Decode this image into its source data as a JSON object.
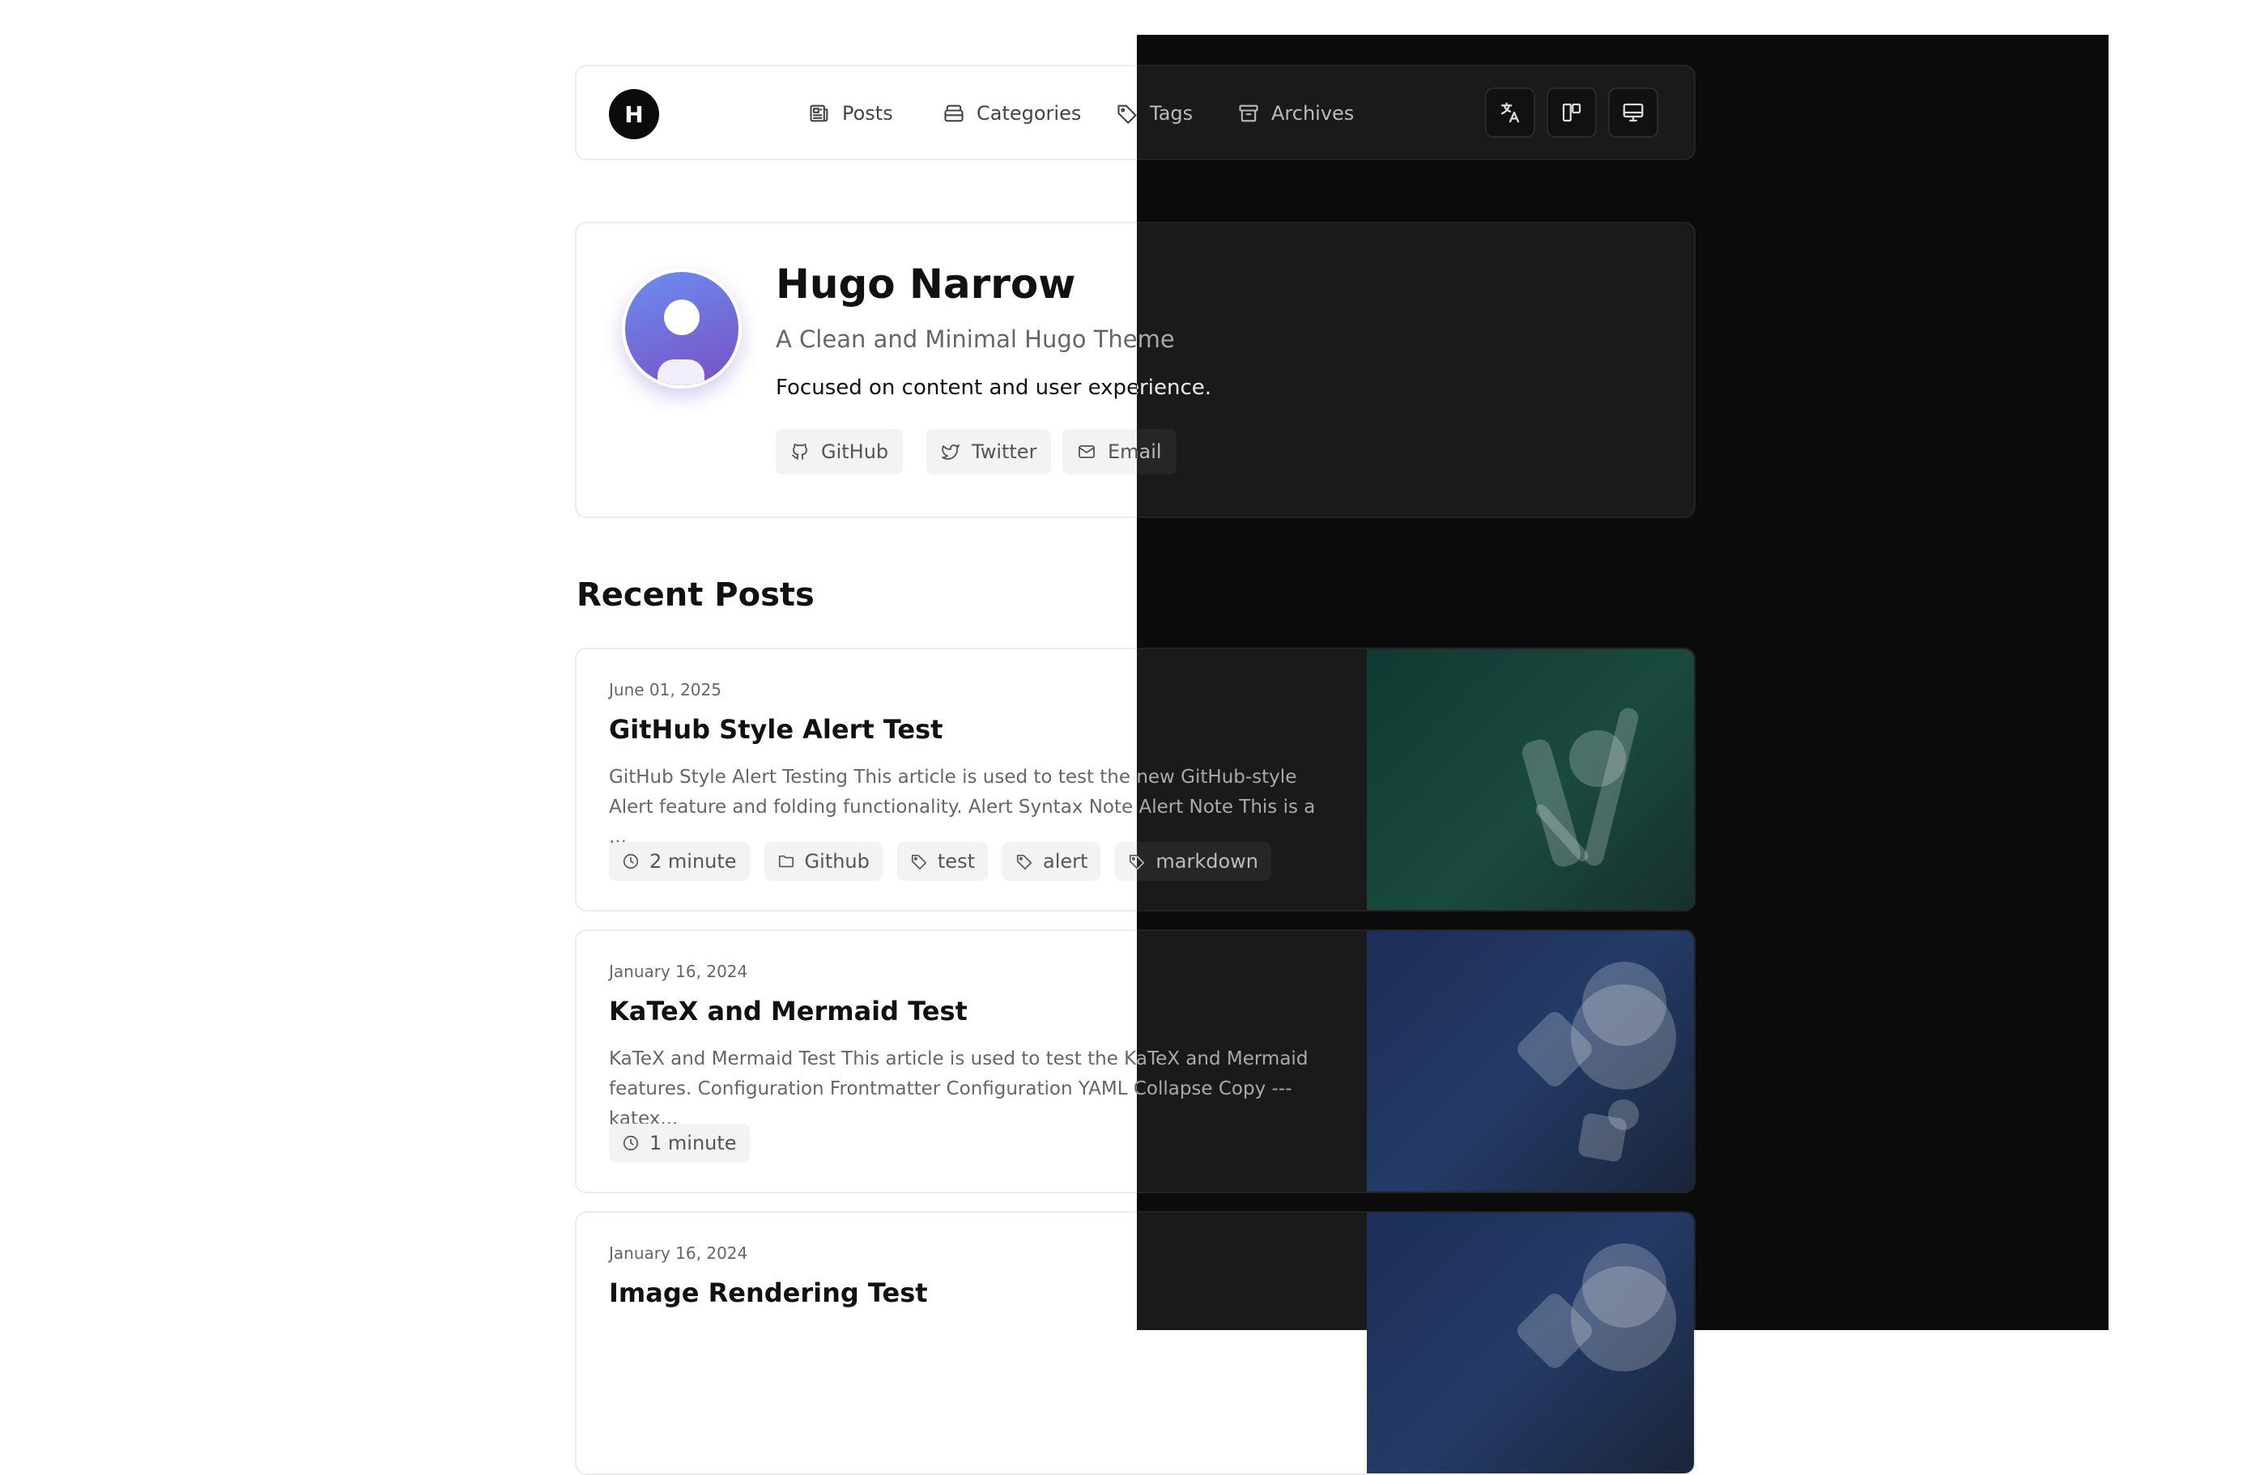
{
  "site": {
    "logo_letter": "H"
  },
  "nav": {
    "items": [
      {
        "label": "Posts",
        "icon": "newspaper-icon"
      },
      {
        "label": "Categories",
        "icon": "folder-icon"
      },
      {
        "label": "Tags",
        "icon": "tag-icon"
      },
      {
        "label": "Archives",
        "icon": "archive-icon"
      }
    ],
    "actions": [
      {
        "icon": "language-icon"
      },
      {
        "icon": "layout-icon"
      },
      {
        "icon": "theme-icon"
      }
    ]
  },
  "profile": {
    "name": "Hugo Narrow",
    "tagline": "A Clean and Minimal Hugo Theme",
    "description": "Focused on content and user experience.",
    "links": [
      {
        "label": "GitHub",
        "icon": "github-icon"
      },
      {
        "label": "Twitter",
        "icon": "twitter-icon"
      },
      {
        "label": "Email",
        "icon": "mail-icon"
      }
    ]
  },
  "recent": {
    "title": "Recent Posts"
  },
  "posts": [
    {
      "date": "June 01, 2025",
      "title": "GitHub Style Alert Test",
      "excerpt": "GitHub Style Alert Testing This article is used to test the new GitHub-style Alert feature and folding functionality. Alert Syntax Note Alert Note This is a ...",
      "reading_time": "2 minute",
      "category": "Github",
      "tags": [
        "test",
        "alert",
        "markdown"
      ],
      "thumb_color": "#0f3a32"
    },
    {
      "date": "January 16, 2024",
      "title": "KaTeX and Mermaid Test",
      "excerpt": "KaTeX and Mermaid Test This article is used to test the KaTeX and Mermaid features. Configuration Frontmatter Configuration YAML Collapse Copy --- katex...",
      "reading_time": "1 minute",
      "thumb_color": "#1b2f57"
    },
    {
      "date": "January 16, 2024",
      "title": "Image Rendering Test",
      "thumb_color": "#1b2f57"
    }
  ]
}
